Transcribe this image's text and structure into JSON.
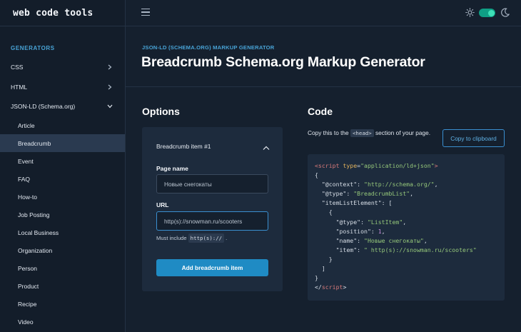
{
  "brand": "web code tools",
  "sidebar": {
    "section_label": "GENERATORS",
    "items": [
      {
        "label": "CSS"
      },
      {
        "label": "HTML"
      },
      {
        "label": "JSON-LD (Schema.org)"
      }
    ],
    "sub_items": [
      {
        "label": "Article"
      },
      {
        "label": "Breadcrumb"
      },
      {
        "label": "Event"
      },
      {
        "label": "FAQ"
      },
      {
        "label": "How-to"
      },
      {
        "label": "Job Posting"
      },
      {
        "label": "Local Business"
      },
      {
        "label": "Organization"
      },
      {
        "label": "Person"
      },
      {
        "label": "Product"
      },
      {
        "label": "Recipe"
      },
      {
        "label": "Video"
      }
    ],
    "active": "Breadcrumb"
  },
  "header": {
    "eyebrow": "JSON-LD (SCHEMA.ORG) MARKUP GENERATOR",
    "title": "Breadcrumb Schema.org Markup Generator"
  },
  "options": {
    "title": "Options",
    "item_title": "Breadcrumb item #1",
    "page_name_label": "Page name",
    "page_name_value": "Новые снегокаты",
    "url_label": "URL",
    "url_value": "http(s)://snowman.ru/scooters",
    "hint_prefix": "Must include",
    "hint_code": "http(s)://",
    "hint_suffix": ".",
    "add_button": "Add breadcrumb item"
  },
  "code": {
    "title": "Code",
    "desc_before": "Copy this to the",
    "desc_code": "<head>",
    "desc_after": "section of your page.",
    "copy_button": "Copy to clipboard",
    "tokens": {
      "open_tag": "<script",
      "type_attr": "type",
      "type_value": "\"application/ld+json\"",
      "open_close": ">",
      "brace_open": "{",
      "context_key": "\"@context\"",
      "context_value": "\"http://schema.org/\"",
      "type_key": "\"@type\"",
      "breadcrumb_type": "\"BreadcrumbList\"",
      "list_key": "\"itemListElement\"",
      "bracket_open": "[",
      "item_brace_open": "{",
      "listitem_type": "\"ListItem\"",
      "position_key": "\"position\"",
      "position_value": "1",
      "name_key": "\"name\"",
      "name_value": "\"Новые снегокаты\"",
      "item_key": "\"item\"",
      "item_value": "\" http(s)://snowman.ru/scooters\"",
      "item_brace_close": "}",
      "bracket_close": "]",
      "brace_close": "}",
      "close_tag_start": "</",
      "close_tag_name": "script",
      "close_tag_end": ">"
    }
  },
  "colors": {
    "accent": "#1f8bc4",
    "toggle": "#0f9f85",
    "background": "#15202e"
  }
}
